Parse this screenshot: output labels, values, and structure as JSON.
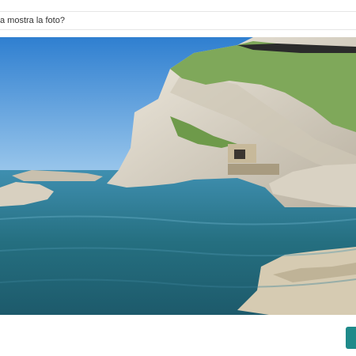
{
  "question": {
    "text": "a mostra la foto?"
  },
  "photo": {
    "subject": "coastal-cliff-sea-photo"
  },
  "colors": {
    "accent": "#1f8a8a",
    "sky": "#3f8fd9",
    "sea": "#2a6f86",
    "cliff": "#e3ddd0",
    "vegetation": "#7fa85a"
  }
}
